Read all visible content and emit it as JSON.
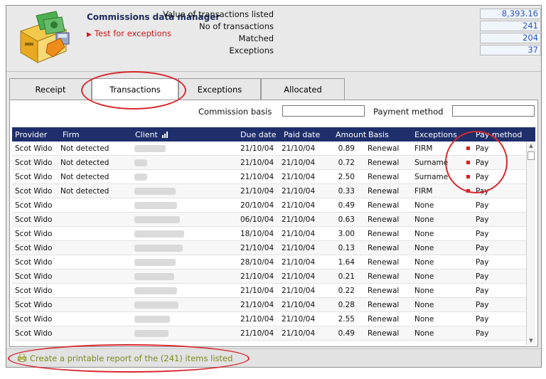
{
  "app": {
    "title": "Commissions data manager",
    "test_link": "Test for exceptions"
  },
  "stats": [
    {
      "label": "Value of transactions listed",
      "value": "8,393.16"
    },
    {
      "label": "No of transactions",
      "value": "241"
    },
    {
      "label": "Matched",
      "value": "204"
    },
    {
      "label": "Exceptions",
      "value": "37"
    }
  ],
  "tabs": [
    {
      "label": "Receipt",
      "active": false
    },
    {
      "label": "Transactions",
      "active": true
    },
    {
      "label": "Exceptions",
      "active": false
    },
    {
      "label": "Allocated",
      "active": false
    }
  ],
  "filters": {
    "commission_basis_label": "Commission basis",
    "commission_basis_value": "",
    "payment_method_label": "Payment method",
    "payment_method_value": ""
  },
  "table": {
    "columns": [
      "Provider",
      "Firm",
      "Client",
      "Due date",
      "Paid date",
      "Amount",
      "Basis",
      "Exceptions",
      "Pay method"
    ],
    "rows": [
      {
        "provider": "Scot Wido",
        "firm": "Not detected",
        "due": "21/10/04",
        "paid": "21/10/04",
        "amount": "0.89",
        "basis": "Renewal",
        "exceptions": "FIRM",
        "pay": "Pay",
        "flag": true
      },
      {
        "provider": "Scot Wido",
        "firm": "Not detected",
        "due": "21/10/04",
        "paid": "21/10/04",
        "amount": "0.72",
        "basis": "Renewal",
        "exceptions": "Surname",
        "pay": "Pay",
        "flag": true
      },
      {
        "provider": "Scot Wido",
        "firm": "Not detected",
        "due": "21/10/04",
        "paid": "21/10/04",
        "amount": "2.50",
        "basis": "Renewal",
        "exceptions": "Surname",
        "pay": "Pay",
        "flag": true
      },
      {
        "provider": "Scot Wido",
        "firm": "Not detected",
        "due": "21/10/04",
        "paid": "21/10/04",
        "amount": "0.33",
        "basis": "Renewal",
        "exceptions": "FIRM",
        "pay": "Pay",
        "flag": true
      },
      {
        "provider": "Scot Wido",
        "firm": "",
        "due": "20/10/04",
        "paid": "21/10/04",
        "amount": "0.49",
        "basis": "Renewal",
        "exceptions": "None",
        "pay": "Pay",
        "flag": false
      },
      {
        "provider": "Scot Wido",
        "firm": "",
        "due": "06/10/04",
        "paid": "21/10/04",
        "amount": "0.63",
        "basis": "Renewal",
        "exceptions": "None",
        "pay": "Pay",
        "flag": false
      },
      {
        "provider": "Scot Wido",
        "firm": "",
        "due": "18/10/04",
        "paid": "21/10/04",
        "amount": "3.00",
        "basis": "Renewal",
        "exceptions": "None",
        "pay": "Pay",
        "flag": false
      },
      {
        "provider": "Scot Wido",
        "firm": "",
        "due": "21/10/04",
        "paid": "21/10/04",
        "amount": "0.13",
        "basis": "Renewal",
        "exceptions": "None",
        "pay": "Pay",
        "flag": false
      },
      {
        "provider": "Scot Wido",
        "firm": "",
        "due": "28/10/04",
        "paid": "21/10/04",
        "amount": "1.64",
        "basis": "Renewal",
        "exceptions": "None",
        "pay": "Pay",
        "flag": false
      },
      {
        "provider": "Scot Wido",
        "firm": "",
        "due": "21/10/04",
        "paid": "21/10/04",
        "amount": "0.21",
        "basis": "Renewal",
        "exceptions": "None",
        "pay": "Pay",
        "flag": false
      },
      {
        "provider": "Scot Wido",
        "firm": "",
        "due": "21/10/04",
        "paid": "21/10/04",
        "amount": "0.22",
        "basis": "Renewal",
        "exceptions": "None",
        "pay": "Pay",
        "flag": false
      },
      {
        "provider": "Scot Wido",
        "firm": "",
        "due": "21/10/04",
        "paid": "21/10/04",
        "amount": "0.28",
        "basis": "Renewal",
        "exceptions": "None",
        "pay": "Pay",
        "flag": false
      },
      {
        "provider": "Scot Wido",
        "firm": "",
        "due": "21/10/04",
        "paid": "21/10/04",
        "amount": "2.55",
        "basis": "Renewal",
        "exceptions": "None",
        "pay": "Pay",
        "flag": false
      },
      {
        "provider": "Scot Wido",
        "firm": "",
        "due": "21/10/04",
        "paid": "21/10/04",
        "amount": "0.49",
        "basis": "Renewal",
        "exceptions": "None",
        "pay": "Pay",
        "flag": false
      }
    ]
  },
  "footer": {
    "report_link": "Create a printable report of the (241) items listed"
  },
  "colors": {
    "header_bar": "#1f2f6c",
    "annotation": "#d8282e",
    "flag": "#e01818",
    "value_text": "#2a56c2"
  }
}
